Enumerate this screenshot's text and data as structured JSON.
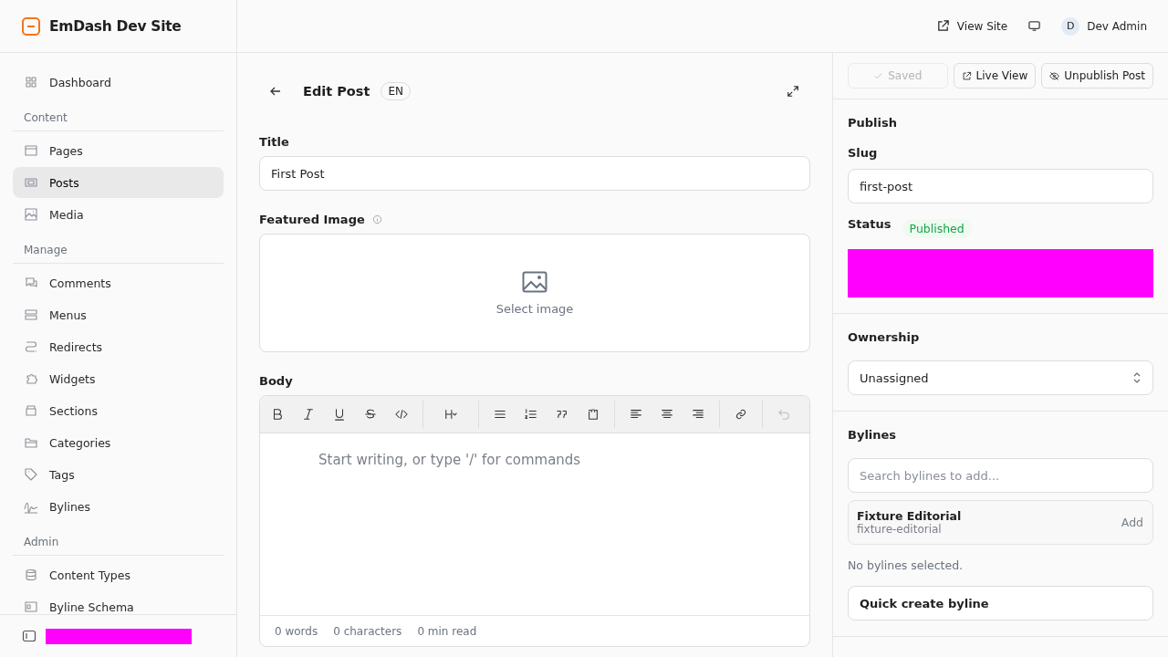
{
  "site": {
    "name": "EmDash Dev Site"
  },
  "topbar": {
    "view_site": "View Site",
    "user": {
      "initial": "D",
      "name": "Dev Admin"
    }
  },
  "sidebar": {
    "groups": [
      {
        "items": [
          {
            "label": "Dashboard",
            "selected": false
          }
        ]
      },
      {
        "heading": "Content",
        "items": [
          {
            "label": "Pages",
            "selected": false
          },
          {
            "label": "Posts",
            "selected": true
          },
          {
            "label": "Media",
            "selected": false
          }
        ]
      },
      {
        "heading": "Manage",
        "items": [
          {
            "label": "Comments",
            "selected": false
          },
          {
            "label": "Menus",
            "selected": false
          },
          {
            "label": "Redirects",
            "selected": false
          },
          {
            "label": "Widgets",
            "selected": false
          },
          {
            "label": "Sections",
            "selected": false
          },
          {
            "label": "Categories",
            "selected": false
          },
          {
            "label": "Tags",
            "selected": false
          },
          {
            "label": "Bylines",
            "selected": false
          }
        ]
      },
      {
        "heading": "Admin",
        "items": [
          {
            "label": "Content Types",
            "selected": false
          },
          {
            "label": "Byline Schema",
            "selected": false
          }
        ]
      }
    ]
  },
  "editor": {
    "heading": "Edit Post",
    "locale": "EN",
    "title_label": "Title",
    "title_value": "First Post",
    "image_label": "Featured Image",
    "image_button": "Select image",
    "body_label": "Body",
    "toolbar": [
      {
        "kind": "bold"
      },
      {
        "kind": "italic"
      },
      {
        "kind": "underline"
      },
      {
        "kind": "strike"
      },
      {
        "kind": "code"
      },
      {
        "kind": "divider"
      },
      {
        "kind": "heading"
      },
      {
        "kind": "divider"
      },
      {
        "kind": "bullets"
      },
      {
        "kind": "numbers"
      },
      {
        "kind": "quote"
      },
      {
        "kind": "codeblock"
      },
      {
        "kind": "divider"
      },
      {
        "kind": "left"
      },
      {
        "kind": "center"
      },
      {
        "kind": "right"
      },
      {
        "kind": "divider"
      },
      {
        "kind": "link"
      },
      {
        "kind": "divider"
      },
      {
        "kind": "undo",
        "disabled": true
      }
    ],
    "placeholder": "Start writing, or type '/' for commands",
    "stats": [
      "0 words",
      "0 characters",
      "0 min read"
    ]
  },
  "panel": {
    "actions": [
      {
        "label": "Saved",
        "kind": "saved",
        "disabled": true
      },
      {
        "label": "Live View",
        "kind": "live"
      },
      {
        "label": "Unpublish Post",
        "kind": "unpublish"
      }
    ],
    "publish": {
      "heading": "Publish",
      "slug_label": "Slug",
      "slug": "first-post",
      "status_label": "Status",
      "status": "Published"
    },
    "ownership": {
      "heading": "Ownership",
      "value": "Unassigned"
    },
    "bylines": {
      "heading": "Bylines",
      "placeholder": "Search bylines to add...",
      "results": [
        {
          "name": "Fixture Editorial",
          "slug": "fixture-editorial",
          "action": "Add"
        }
      ],
      "empty": "No bylines selected.",
      "create": "Quick create byline"
    }
  }
}
